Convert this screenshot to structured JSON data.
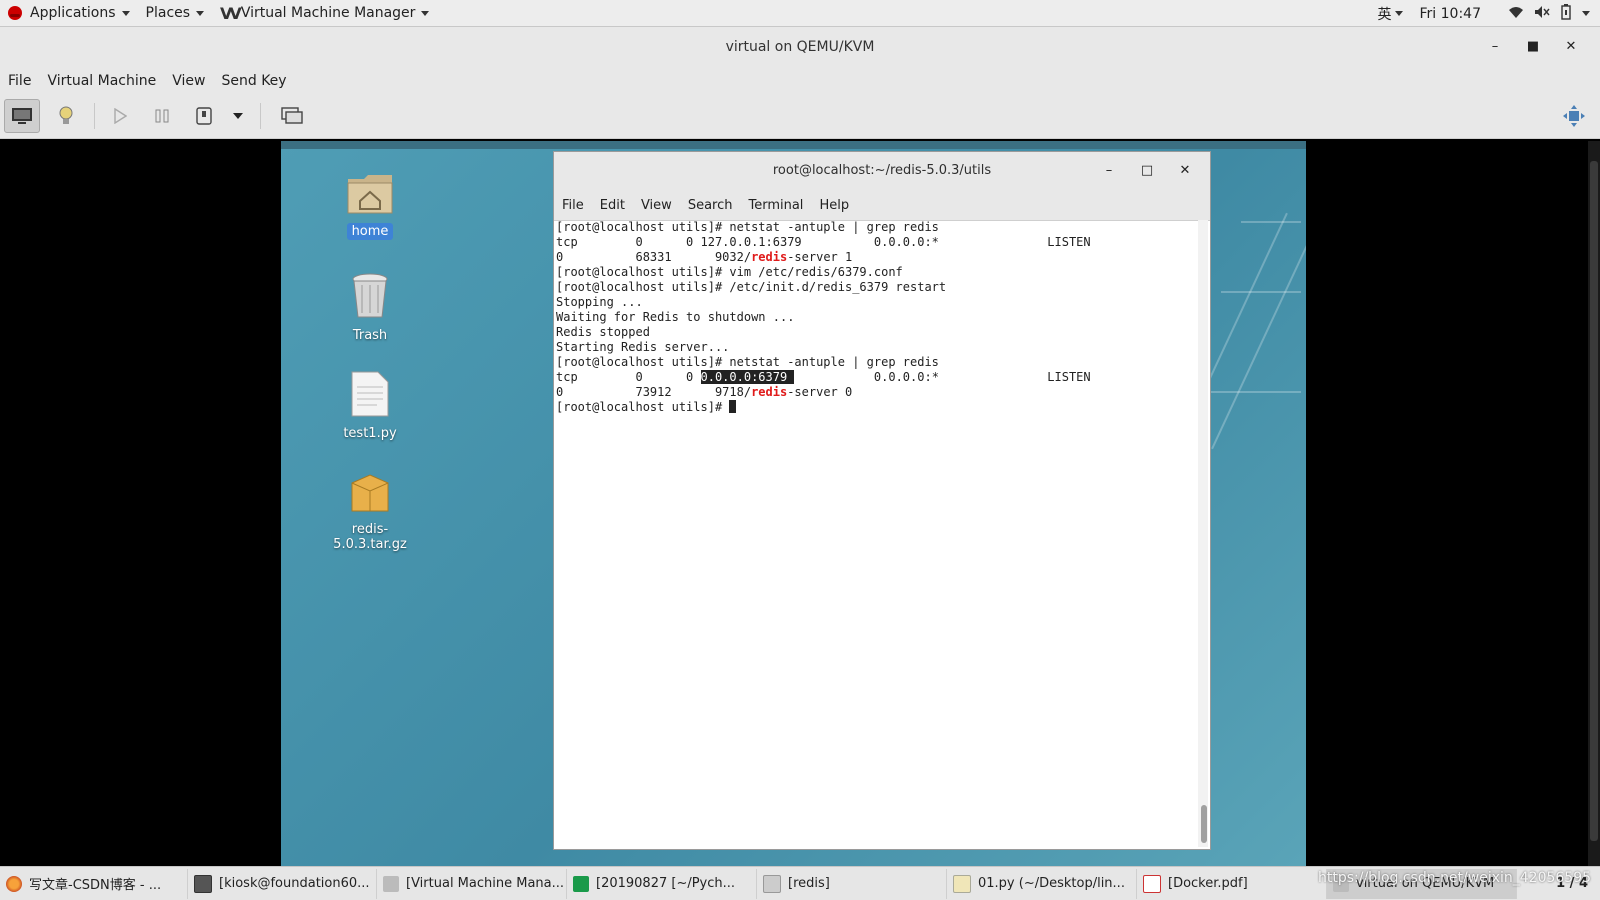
{
  "topbar": {
    "applications_label": "Applications",
    "places_label": "Places",
    "vmm_logo": "VV",
    "app_name": "Virtual Machine Manager",
    "input_method": "英",
    "clock": "Fri 10:47"
  },
  "window": {
    "title": "virtual on QEMU/KVM",
    "menu": [
      "File",
      "Virtual Machine",
      "View",
      "Send Key"
    ]
  },
  "desktop": {
    "icons": [
      {
        "label": "home",
        "icon": "home-folder-icon"
      },
      {
        "label": "Trash",
        "icon": "trash-icon"
      },
      {
        "label": "test1.py",
        "icon": "text-file-icon"
      },
      {
        "label": "redis-5.0.3.tar.gz",
        "icon": "archive-icon"
      }
    ]
  },
  "terminal": {
    "title": "root@localhost:~/redis-5.0.3/utils",
    "menu": [
      "File",
      "Edit",
      "View",
      "Search",
      "Terminal",
      "Help"
    ],
    "lines": {
      "l1": "[root@localhost utils]# netstat -antuple | grep redis",
      "l2": "tcp        0      0 127.0.0.1:6379          0.0.0.0:*               LISTEN",
      "l3_pre": "0          68331      9032/",
      "l3_red": "redis",
      "l3_post": "-server 1",
      "l4": "[root@localhost utils]# vim /etc/redis/6379.conf",
      "l5": "[root@localhost utils]# /etc/init.d/redis_6379 restart",
      "l6": "Stopping ...",
      "l7": "Waiting for Redis to shutdown ...",
      "l8": "Redis stopped",
      "l9": "Starting Redis server...",
      "l10": "[root@localhost utils]# netstat -antuple | grep redis",
      "l11_pre": "tcp        0      0 ",
      "l11_hl": "0.0.0.0:6379 ",
      "l11_post": "           0.0.0.0:*               LISTEN",
      "l12_pre": "0          73912      9718/",
      "l12_red": "redis",
      "l12_post": "-server 0",
      "l13": "[root@localhost utils]# "
    }
  },
  "taskbar": {
    "items": [
      {
        "label": "写文章-CSDN博客 - ...",
        "icon": "firefox-icon"
      },
      {
        "label": "[kiosk@foundation60...",
        "icon": "terminal-icon"
      },
      {
        "label": "[Virtual Machine Mana...",
        "icon": "vmm-icon"
      },
      {
        "label": "[20190827 [~/Pych...",
        "icon": "pycharm-icon"
      },
      {
        "label": "[redis]",
        "icon": "folder-icon"
      },
      {
        "label": "01.py (~/Desktop/lin...",
        "icon": "gedit-icon"
      },
      {
        "label": "[Docker.pdf]",
        "icon": "pdf-icon"
      },
      {
        "label": "virtual on QEMU/KVM",
        "icon": "vmm-icon"
      }
    ],
    "pager": "1 / 4"
  },
  "watermark": "https://blog.csdn.net/weixin_42056595",
  "colors": {
    "accent": "#3e83d6",
    "desktop_bg": "#4f9db5",
    "redis_red": "#e01b1b"
  }
}
